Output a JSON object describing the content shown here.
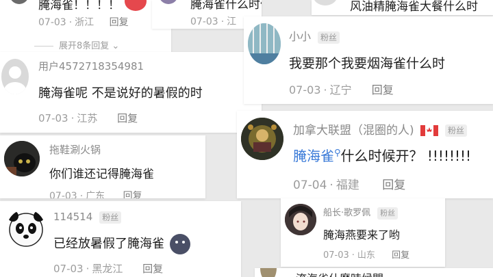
{
  "colors": {
    "background": "#e9e9e9",
    "card": "#ffffff",
    "meta": "#9c9c9c",
    "link": "#3b7bd8"
  },
  "top_left": {
    "text": "腌海雀！！！！",
    "date": "07-03",
    "location": "浙江",
    "reply": "回复",
    "expand": "展开8条回复"
  },
  "top_mid": {
    "text": "腌海雀什么时候发？",
    "date": "07-03",
    "location": "江"
  },
  "top_right": {
    "text": "风油精腌海雀大餐什么时"
  },
  "comment_user457": {
    "username": "用户4572718354981",
    "text": "腌海雀呢 不是说好的暑假的时",
    "date": "07-03",
    "location": "江苏",
    "reply": "回复"
  },
  "comment_tuoxie": {
    "username": "拖鞋涮火锅",
    "text": "你们谁还记得腌海雀",
    "date": "07-03",
    "location": "广东",
    "reply": "回复"
  },
  "comment_114514": {
    "username": "114514",
    "badge": "粉丝",
    "text": "已经放暑假了腌海雀",
    "date": "07-03",
    "location": "黑龙江",
    "reply": "回复"
  },
  "comment_xiaoxiao": {
    "username": "小小",
    "badge": "粉丝",
    "text": "我要那个我要烟海雀什么时",
    "date": "07-03",
    "location": "辽宁",
    "reply": "回复"
  },
  "comment_canada": {
    "username": "加拿大联盟（混圈的人)",
    "badge": "粉丝",
    "link_text": "腌海雀",
    "text_after": "什么时候开？ !!!!!!!!",
    "date": "07-04",
    "location": "福建",
    "reply": "回复"
  },
  "comment_chuanzhang": {
    "username": "船长·歌罗佩",
    "badge": "粉丝",
    "text": "腌海燕要来了哟",
    "date": "07-03",
    "location": "山东",
    "reply": "回复"
  },
  "bottom_right": {
    "text": "淹海雀什麼時候開"
  }
}
